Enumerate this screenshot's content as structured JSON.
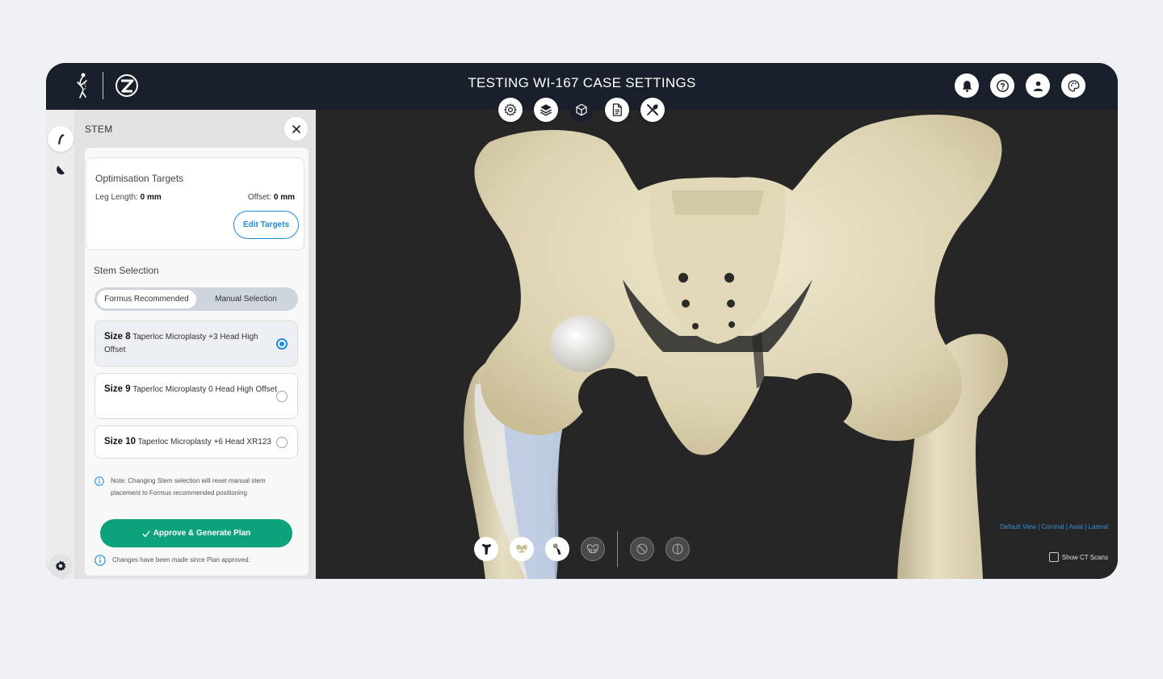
{
  "header": {
    "title": "TESTING WI-167 CASE SETTINGS"
  },
  "panel": {
    "title": "STEM",
    "targets": {
      "title": "Optimisation Targets",
      "leg_label": "Leg Length: ",
      "leg_value": "0 mm",
      "offset_label": "Offset: ",
      "offset_value": "0 mm",
      "edit_button": "Edit Targets"
    },
    "stem_selection": {
      "label": "Stem Selection",
      "tabs": [
        "Formus Recommended",
        "Manual Selection"
      ],
      "active_tab": "Formus Recommended",
      "options": [
        {
          "size": "Size 8",
          "desc": "Taperloc Microplasty +3 Head High Offset",
          "selected": true
        },
        {
          "size": "Size 9",
          "desc": "Taperloc Microplasty 0 Head High Offset",
          "selected": false
        },
        {
          "size": "Size 10",
          "desc": "Taperloc Microplasty +6 Head XR123",
          "selected": false
        }
      ]
    },
    "note": "Note: Changing Stem selection will reset manual stem placement to Formus recommended positioning",
    "approve_button": "Approve & Generate Plan",
    "status": "Changes have been made since Plan approved."
  },
  "viewport": {
    "view_links": [
      "Default View",
      "Coronal",
      "Axial",
      "Lateral"
    ],
    "show_ct_label": "Show CT Scans",
    "show_ct_checked": false
  },
  "colors": {
    "header_bg": "#19202c",
    "accent_blue": "#1f8ad6",
    "approve_green": "#0ea27c",
    "bone": "#e4dcbf",
    "viewport_bg": "#262626"
  },
  "icons": {
    "header": [
      "bell-icon",
      "help-icon",
      "user-icon",
      "palette-icon"
    ],
    "toolbar": [
      "gear-icon",
      "layers-icon",
      "cube-icon",
      "document-icon",
      "tools-icon"
    ],
    "rail": [
      "stem-icon",
      "cup-icon",
      "settings-icon"
    ],
    "view_tools": [
      "femur-icon",
      "pelvis-icon",
      "implant-icon",
      "pelvis-outline-icon",
      "hide-anatomy-icon",
      "split-view-icon"
    ]
  }
}
